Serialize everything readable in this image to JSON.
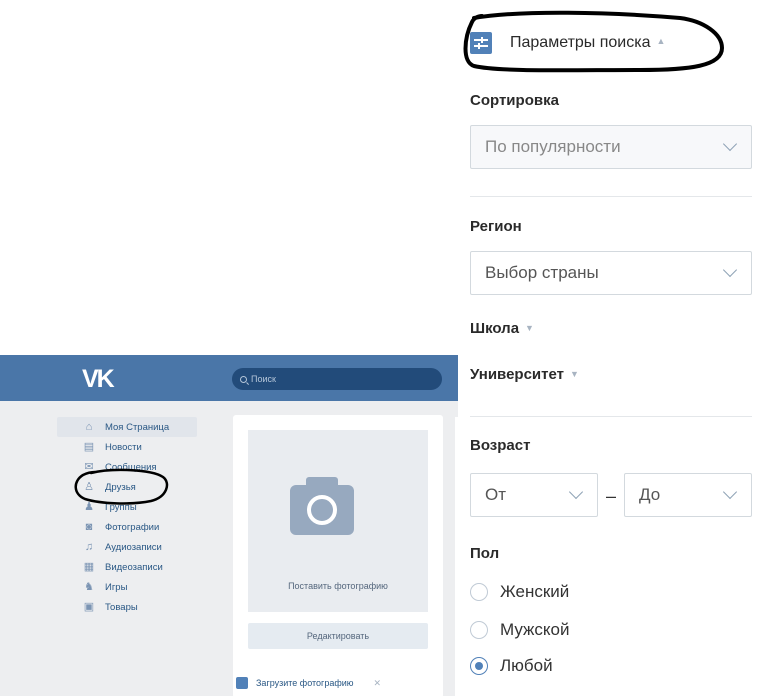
{
  "search_params": {
    "header_title": "Параметры поиска",
    "sort": {
      "label": "Сортировка",
      "selected": "По популярности"
    },
    "region": {
      "label": "Регион",
      "selected": "Выбор страны"
    },
    "school_label": "Школа",
    "university_label": "Университет",
    "age": {
      "label": "Возраст",
      "from": "От",
      "separator": "–",
      "to": "До"
    },
    "gender": {
      "label": "Пол",
      "options": [
        "Женский",
        "Мужской",
        "Любой"
      ],
      "selected": "Любой"
    }
  },
  "vk": {
    "logo": "VK",
    "search_placeholder": "Поиск",
    "menu": [
      {
        "label": "Моя Страница",
        "icon": "home-icon"
      },
      {
        "label": "Новости",
        "icon": "news-icon"
      },
      {
        "label": "Сообщения",
        "icon": "messages-icon"
      },
      {
        "label": "Друзья",
        "icon": "friends-icon"
      },
      {
        "label": "Группы",
        "icon": "groups-icon"
      },
      {
        "label": "Фотографии",
        "icon": "camera-icon"
      },
      {
        "label": "Аудиозаписи",
        "icon": "music-icon"
      },
      {
        "label": "Видеозаписи",
        "icon": "video-icon"
      },
      {
        "label": "Игры",
        "icon": "games-icon"
      },
      {
        "label": "Товары",
        "icon": "goods-icon"
      }
    ],
    "photo_label": "Поставить фотографию",
    "edit_button": "Редактировать",
    "upload_label": "Загрузите фотографию"
  },
  "colors": {
    "brand_blue": "#4a76a8",
    "accent": "#5181b8",
    "annotation_ink": "#000000"
  }
}
